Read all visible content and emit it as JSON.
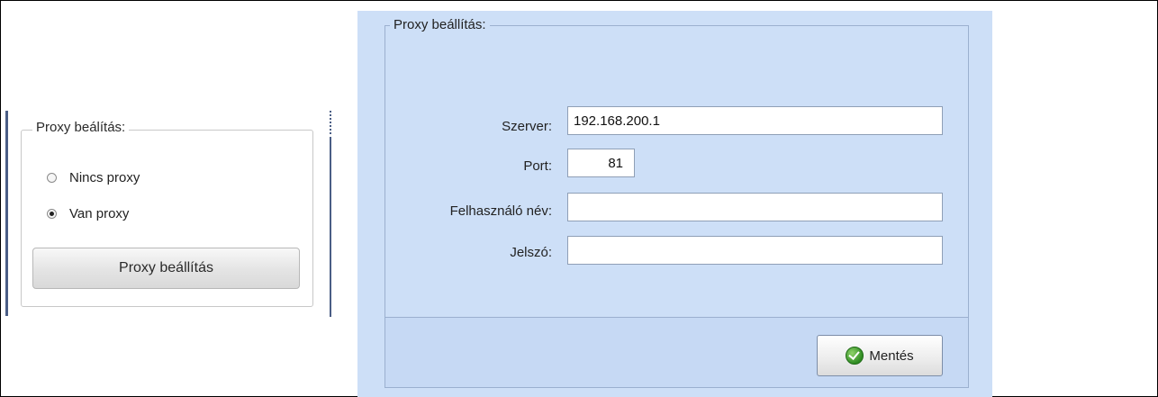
{
  "left_panel": {
    "group_title": "Proxy beálítás:",
    "options": [
      {
        "label": "Nincs proxy",
        "checked": false
      },
      {
        "label": "Van proxy",
        "checked": true
      }
    ],
    "settings_button_label": "Proxy beállítás"
  },
  "right_panel": {
    "group_title": "Proxy beállítás:",
    "fields": {
      "server": {
        "label": "Szerver:",
        "value": "192.168.200.1"
      },
      "port": {
        "label": "Port:",
        "value": "81"
      },
      "username": {
        "label": "Felhasználó név:",
        "value": ""
      },
      "password": {
        "label": "Jelszó:",
        "value": ""
      }
    },
    "save_button": {
      "label": "Mentés",
      "icon": "check-circle-icon"
    }
  },
  "colors": {
    "panel_bg": "#cddff7",
    "accent_bar": "#4a5d85",
    "save_icon": "#2e8b22"
  }
}
